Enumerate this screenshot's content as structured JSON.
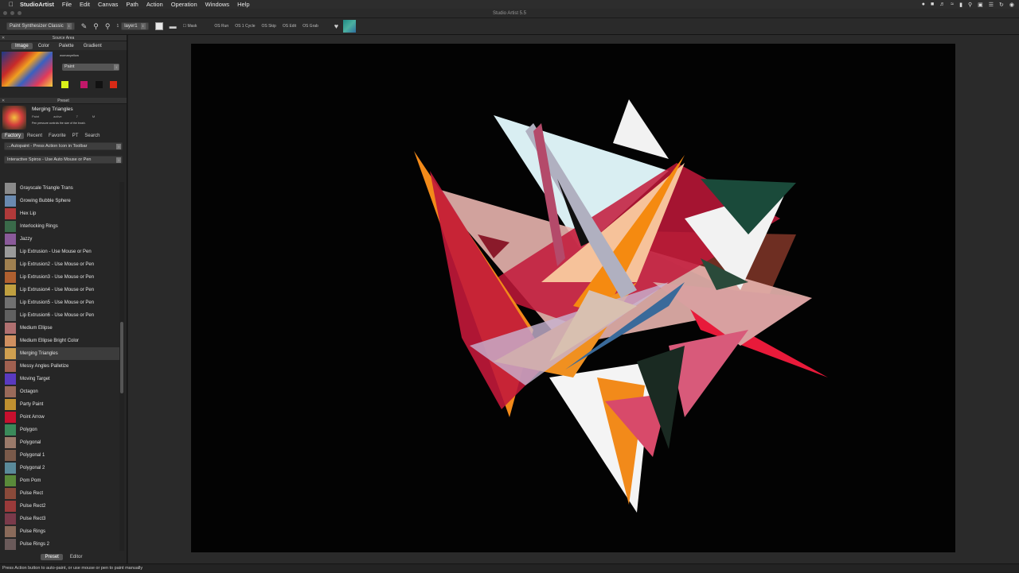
{
  "menubar": {
    "app": "StudioArtist",
    "items": [
      "File",
      "Edit",
      "Canvas",
      "Path",
      "Action",
      "Operation",
      "Windows",
      "Help"
    ]
  },
  "window": {
    "title": "Studio Artist 5.5"
  },
  "toolbar": {
    "paint_synth": "Paint Synthesizer Classic",
    "layer_count": "1",
    "layer_name": "layer1",
    "mask_label": "Mask",
    "os_buttons": [
      "OS Run",
      "OS 1 Cycle",
      "OS Skip",
      "OS Edit",
      "OS Grab"
    ]
  },
  "source_area": {
    "header": "Source Area",
    "tabs": [
      "Image",
      "Color",
      "Palette",
      "Gradient"
    ],
    "selected_tab": "Image",
    "image_name": "womanyellow",
    "mode": "Paint",
    "swatches": [
      "#d9f01a",
      "#c2186a",
      "#111111",
      "#d92a16"
    ]
  },
  "preset": {
    "header": "Preset",
    "name": "Merging Triangles",
    "sub1": "Paint",
    "sub2": "active",
    "sub3": "7",
    "sub4": "M",
    "description": "Pen pressure controls the size of the brush.",
    "tabs": [
      "Factory",
      "Recent",
      "Favorite",
      "PT",
      "Search"
    ],
    "selected_tab": "Factory",
    "category": "...Autopaint - Press Action Icon in Toolbar",
    "subcategory": "Interactive Spiros - Use Auto Mouse or Pen",
    "list": [
      {
        "label": "Grayscale Triangle Trans",
        "color": "#8a8a8a"
      },
      {
        "label": "Growing Bubble Sphere",
        "color": "#6a8ab0"
      },
      {
        "label": "Hex Lip",
        "color": "#b03a3a"
      },
      {
        "label": "Interlocking Rings",
        "color": "#3a6a4a"
      },
      {
        "label": "Jazzy",
        "color": "#8a5a9a"
      },
      {
        "label": "Lip Extrusion - Use Mouse or Pen",
        "color": "#9a9a9a"
      },
      {
        "label": "Lip Extrusion2 - Use Mouse or Pen",
        "color": "#a08050"
      },
      {
        "label": "Lip Extrusion3 - Use Mouse or Pen",
        "color": "#b06030"
      },
      {
        "label": "Lip Extrusion4 - Use Mouse or Pen",
        "color": "#c0a040"
      },
      {
        "label": "Lip Extrusion5 - Use Mouse or Pen",
        "color": "#707070"
      },
      {
        "label": "Lip Extrusion6 - Use Mouse or Pen",
        "color": "#606060"
      },
      {
        "label": "Medium Ellipse",
        "color": "#b07070"
      },
      {
        "label": "Medium Ellipse Bright Color",
        "color": "#d09060"
      },
      {
        "label": "Merging Triangles",
        "color": "#d0a050"
      },
      {
        "label": "Messy Angles Palletize",
        "color": "#a06050"
      },
      {
        "label": "Moving Target",
        "color": "#5a3ac0"
      },
      {
        "label": "Octagon",
        "color": "#9a6a5a"
      },
      {
        "label": "Party Paint",
        "color": "#c09030"
      },
      {
        "label": "Point Arrow",
        "color": "#c8102e"
      },
      {
        "label": "Polygon",
        "color": "#3a8a5a"
      },
      {
        "label": "Polygonal",
        "color": "#9a7a6a"
      },
      {
        "label": "Polygonal 1",
        "color": "#7a5a4a"
      },
      {
        "label": "Polygonal 2",
        "color": "#5a8a9a"
      },
      {
        "label": "Pom Pom",
        "color": "#5a8a3a"
      },
      {
        "label": "Pulse Rect",
        "color": "#8a4a3a"
      },
      {
        "label": "Pulse Rect2",
        "color": "#9a3a3a"
      },
      {
        "label": "Pulse Rect3",
        "color": "#7a3a4a"
      },
      {
        "label": "Pulse Rings",
        "color": "#8a6a5a"
      },
      {
        "label": "Pulse Rings 2",
        "color": "#6a5a5a"
      }
    ],
    "selected_item": "Merging Triangles",
    "bottom_tabs": [
      "Preset",
      "Editor"
    ],
    "selected_bottom_tab": "Preset"
  },
  "statusbar": {
    "text": "Press Action button to auto-paint, or use mouse or pen to paint manually"
  }
}
